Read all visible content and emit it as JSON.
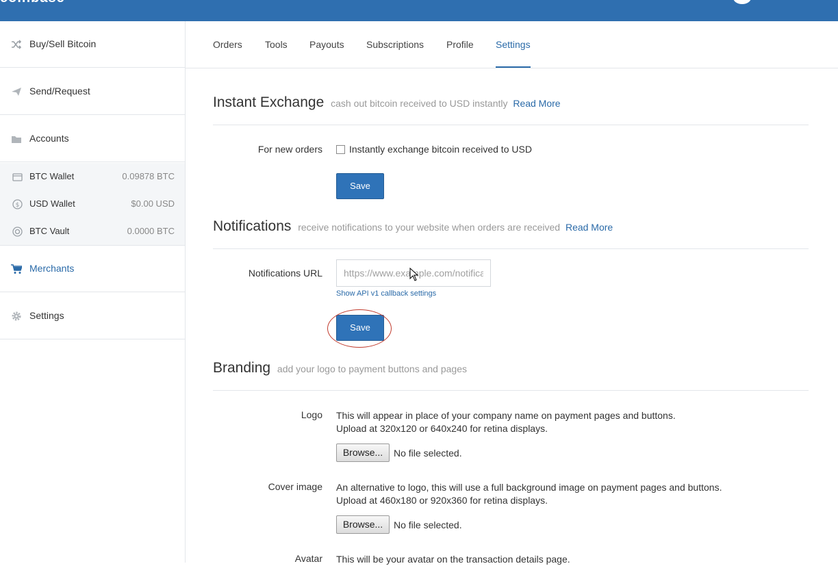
{
  "topbar": {
    "brand": "coinbase"
  },
  "sidebar": {
    "items": [
      {
        "label": "Buy/Sell Bitcoin",
        "icon": "shuffle-icon"
      },
      {
        "label": "Send/Request",
        "icon": "send-icon"
      },
      {
        "label": "Accounts",
        "icon": "folder-icon"
      },
      {
        "label": "Merchants",
        "icon": "cart-icon",
        "active": true
      },
      {
        "label": "Settings",
        "icon": "gear-icon"
      }
    ],
    "accounts": [
      {
        "name": "BTC Wallet",
        "balance": "0.09878 BTC",
        "icon": "wallet-icon"
      },
      {
        "name": "USD Wallet",
        "balance": "$0.00 USD",
        "icon": "dollar-icon"
      },
      {
        "name": "BTC Vault",
        "balance": "0.0000 BTC",
        "icon": "vault-icon"
      }
    ]
  },
  "tabs": [
    "Orders",
    "Tools",
    "Payouts",
    "Subscriptions",
    "Profile",
    "Settings"
  ],
  "active_tab": "Settings",
  "instant_exchange": {
    "title": "Instant Exchange",
    "subtitle": "cash out bitcoin received to USD instantly",
    "read_more": "Read More",
    "field_label": "For new orders",
    "checkbox_label": "Instantly exchange bitcoin received to USD",
    "checked": false,
    "save_label": "Save"
  },
  "notifications": {
    "title": "Notifications",
    "subtitle": "receive notifications to your website when orders are received",
    "read_more": "Read More",
    "field_label": "Notifications URL",
    "url_placeholder": "https://www.example.com/notifications",
    "api_link": "Show API v1 callback settings",
    "save_label": "Save"
  },
  "branding": {
    "title": "Branding",
    "subtitle": "add your logo to payment buttons and pages",
    "logo": {
      "label": "Logo",
      "line1": "This will appear in place of your company name on payment pages and buttons.",
      "line2": "Upload at 320x120 or 640x240 for retina displays.",
      "browse_label": "Browse...",
      "file_status": "No file selected."
    },
    "cover": {
      "label": "Cover image",
      "line1": "An alternative to logo, this will use a full background image on payment pages and buttons.",
      "line2": "Upload at 460x180 or 920x360 for retina displays.",
      "browse_label": "Browse...",
      "file_status": "No file selected."
    },
    "avatar": {
      "label": "Avatar",
      "line1": "This will be your avatar on the transaction details page."
    }
  },
  "colors": {
    "brand": "#2f6fb0",
    "accent": "#2a6aa8",
    "button": "#2f73b8",
    "highlight": "#c0392b"
  }
}
